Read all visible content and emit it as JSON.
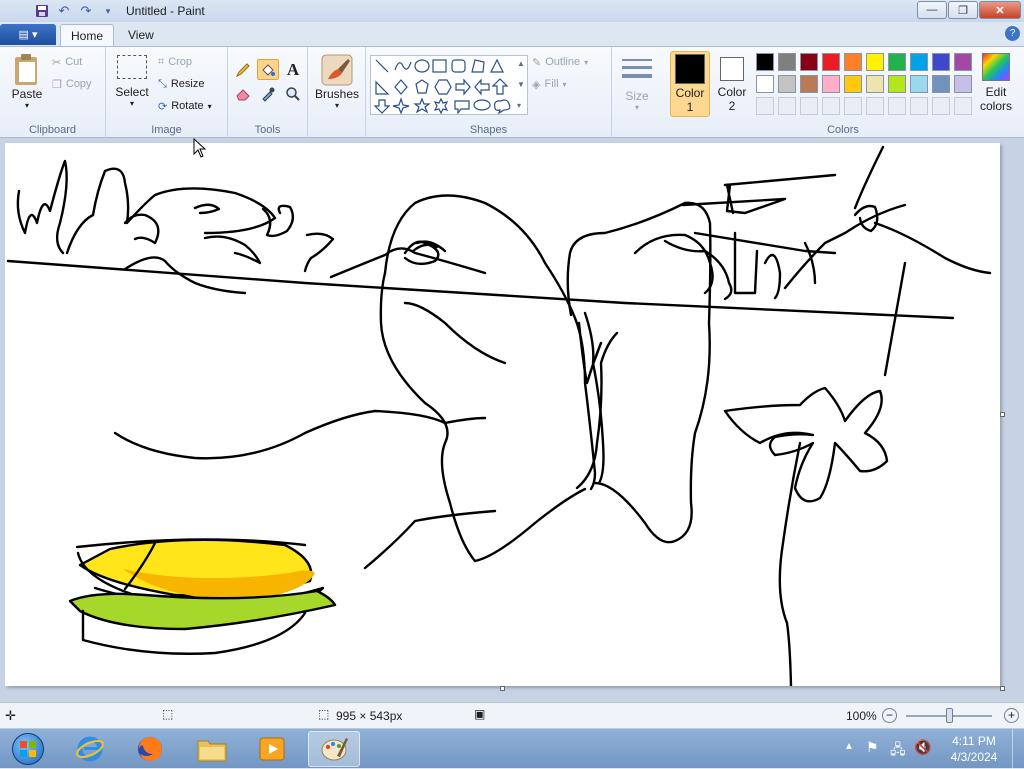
{
  "window": {
    "title": "Untitled - Paint",
    "minimize": "—",
    "maximize": "❐",
    "close": "✕"
  },
  "tabs": {
    "file": "▤ ▾",
    "home": "Home",
    "view": "View",
    "help": "?"
  },
  "clipboard": {
    "group_label": "Clipboard",
    "paste": "Paste",
    "cut": "Cut",
    "copy": "Copy"
  },
  "image": {
    "group_label": "Image",
    "select": "Select",
    "crop": "Crop",
    "resize": "Resize",
    "rotate": "Rotate"
  },
  "tools": {
    "group_label": "Tools"
  },
  "brushes": {
    "label": "Brushes"
  },
  "shapes": {
    "group_label": "Shapes",
    "outline": "Outline",
    "fill": "Fill"
  },
  "size": {
    "label": "Size"
  },
  "colors": {
    "group_label": "Colors",
    "color1_label": "Color",
    "color1_num": "1",
    "color2_label": "Color",
    "color2_num": "2",
    "edit_label": "Edit",
    "edit_label2": "colors",
    "color1": "#000000",
    "color2": "#ffffff",
    "palette_row1": [
      "#000000",
      "#7f7f7f",
      "#880015",
      "#ed1c24",
      "#ff7f27",
      "#fff200",
      "#22b14c",
      "#00a2e8",
      "#3f48cc",
      "#a349a4"
    ],
    "palette_row2": [
      "#ffffff",
      "#c3c3c3",
      "#b97a57",
      "#ffaec9",
      "#ffc90e",
      "#efe4b0",
      "#b5e61d",
      "#99d9ea",
      "#7092be",
      "#c8bfe7"
    ]
  },
  "status": {
    "image_size": "995 × 543px",
    "zoom": "100%"
  },
  "taskbar": {
    "time": "4:11 PM",
    "date": "4/3/2024"
  }
}
